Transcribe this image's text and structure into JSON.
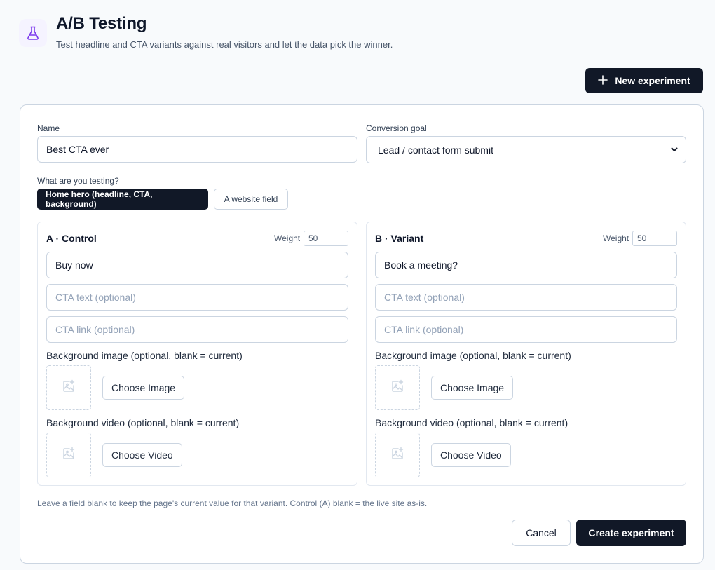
{
  "header": {
    "title": "A/B Testing",
    "subtitle": "Test headline and CTA variants against real visitors and let the data pick the winner.",
    "icon": "flask-icon",
    "accent_color": "#7c3aed"
  },
  "toolbar": {
    "new_experiment_label": "New experiment"
  },
  "form": {
    "name_label": "Name",
    "name_value": "Best CTA ever",
    "goal_label": "Conversion goal",
    "goal_value": "Lead / contact form submit",
    "testing_label": "What are you testing?",
    "testing_options": [
      {
        "label": "Home hero (headline, CTA, background)",
        "selected": true
      },
      {
        "label": "A website field",
        "selected": false
      }
    ]
  },
  "variants": [
    {
      "title": "A · Control",
      "weight_label": "Weight",
      "weight_value": "50",
      "headline_value": "Buy now",
      "cta_text_placeholder": "CTA text (optional)",
      "cta_link_placeholder": "CTA link (optional)",
      "bg_image_label": "Background image (optional, blank = current)",
      "choose_image_label": "Choose Image",
      "bg_video_label": "Background video (optional, blank = current)",
      "choose_video_label": "Choose Video"
    },
    {
      "title": "B · Variant",
      "weight_label": "Weight",
      "weight_value": "50",
      "headline_value": "Book a meeting?",
      "cta_text_placeholder": "CTA text (optional)",
      "cta_link_placeholder": "CTA link (optional)",
      "bg_image_label": "Background image (optional, blank = current)",
      "choose_image_label": "Choose Image",
      "bg_video_label": "Background video (optional, blank = current)",
      "choose_video_label": "Choose Video"
    }
  ],
  "footer": {
    "hint": "Leave a field blank to keep the page's current value for that variant. Control (A) blank = the live site as-is.",
    "cancel_label": "Cancel",
    "create_label": "Create experiment"
  }
}
